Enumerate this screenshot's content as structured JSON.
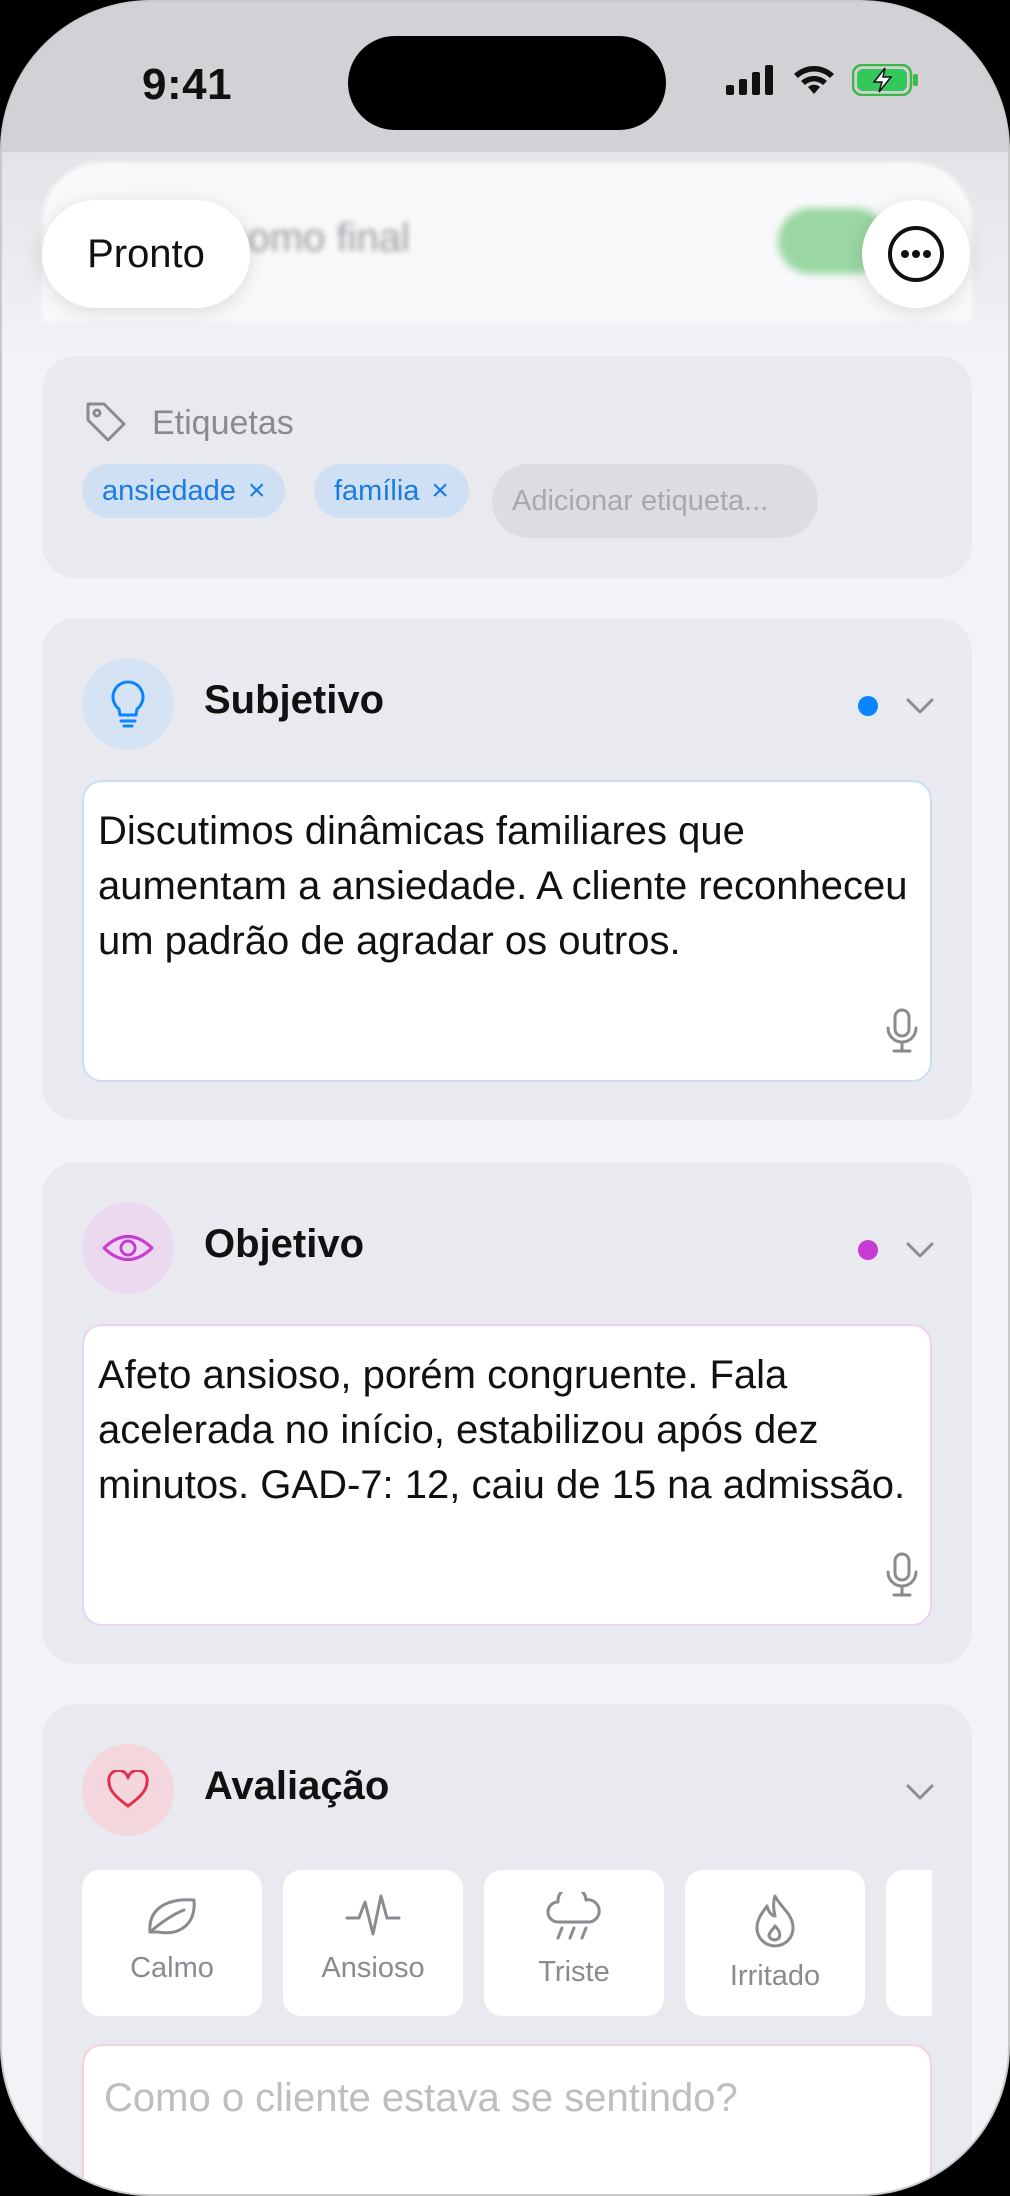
{
  "status": {
    "time": "9:41"
  },
  "header": {
    "done_label": "Pronto",
    "blurred_text": "Marcar como final"
  },
  "tags": {
    "title": "Etiquetas",
    "items": [
      {
        "label": "ansiedade",
        "remove": "×"
      },
      {
        "label": "família",
        "remove": "×"
      }
    ],
    "add_placeholder": "Adicionar etiqueta..."
  },
  "subjective": {
    "title": "Subjetivo",
    "text": "Discutimos dinâmicas familiares que aumentam a ansiedade. A cliente reconheceu um padrão de agradar os outros.",
    "accent": "#0a84ff"
  },
  "objective": {
    "title": "Objetivo",
    "text": "Afeto ansioso, porém congruente. Fala acelerada no início, estabilizou após dez minutos. GAD-7: 12, caiu de 15 na admissão.",
    "accent": "#c83cd6"
  },
  "assessment": {
    "title": "Avaliação",
    "accent": "#e0324e",
    "moods": [
      {
        "label": "Calmo",
        "icon": "leaf-icon"
      },
      {
        "label": "Ansioso",
        "icon": "pulse-icon"
      },
      {
        "label": "Triste",
        "icon": "rain-cloud-icon"
      },
      {
        "label": "Irritado",
        "icon": "flame-icon"
      }
    ],
    "feeling_placeholder": "Como o cliente estava se sentindo?"
  }
}
